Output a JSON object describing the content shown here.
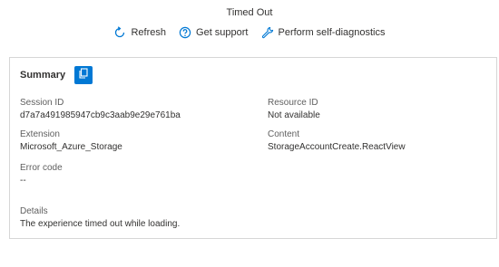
{
  "header": {
    "title": "Timed Out"
  },
  "actions": {
    "refresh": "Refresh",
    "support": "Get support",
    "diagnostics": "Perform self-diagnostics"
  },
  "summary": {
    "title": "Summary",
    "session_id_label": "Session ID",
    "session_id_value": "d7a7a491985947cb9c3aab9e29e761ba",
    "resource_id_label": "Resource ID",
    "resource_id_value": "Not available",
    "extension_label": "Extension",
    "extension_value": "Microsoft_Azure_Storage",
    "content_label": "Content",
    "content_value": "StorageAccountCreate.ReactView",
    "error_code_label": "Error code",
    "error_code_value": "--",
    "details_label": "Details",
    "details_value": "The experience timed out while loading."
  },
  "colors": {
    "accent": "#0078d4",
    "icon": "#0078d4",
    "border": "#d6d6d6"
  },
  "icons": [
    "refresh-icon",
    "help-circle-icon",
    "wrench-icon",
    "copy-icon"
  ]
}
